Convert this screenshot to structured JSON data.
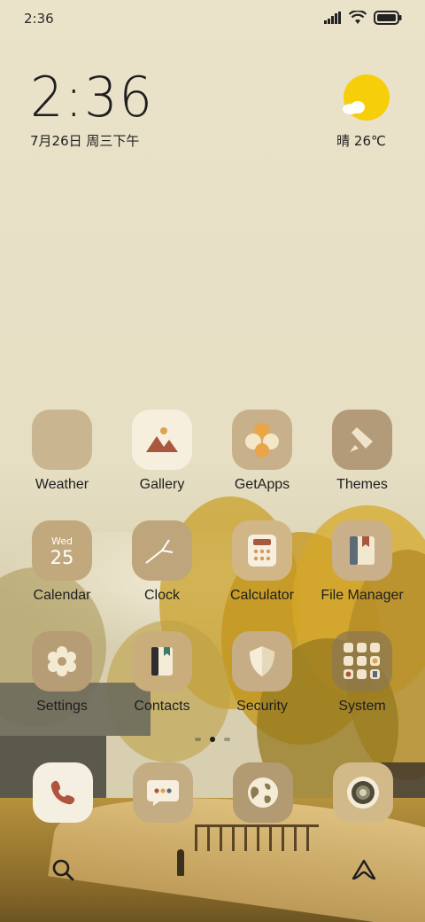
{
  "status_bar": {
    "time": "2:36"
  },
  "clock": {
    "time": "2:36",
    "date": "7月26日 周三下午"
  },
  "weather": {
    "text": "晴 26℃"
  },
  "apps": [
    {
      "label": "Weather",
      "icon": "weather-icon"
    },
    {
      "label": "Gallery",
      "icon": "gallery-icon"
    },
    {
      "label": "GetApps",
      "icon": "getapps-icon"
    },
    {
      "label": "Themes",
      "icon": "themes-icon"
    },
    {
      "label": "Calendar",
      "icon": "calendar-icon",
      "weekday": "Wed",
      "day": "25"
    },
    {
      "label": "Clock",
      "icon": "clock-icon"
    },
    {
      "label": "Calculator",
      "icon": "calculator-icon"
    },
    {
      "label": "File Manager",
      "icon": "file-manager-icon"
    },
    {
      "label": "Settings",
      "icon": "settings-icon"
    },
    {
      "label": "Contacts",
      "icon": "contacts-icon"
    },
    {
      "label": "Security",
      "icon": "security-icon"
    },
    {
      "label": "System",
      "icon": "folder-icon"
    }
  ],
  "dock": [
    {
      "icon": "phone-icon"
    },
    {
      "icon": "messages-icon"
    },
    {
      "icon": "browser-icon"
    },
    {
      "icon": "camera-icon"
    }
  ],
  "colors": {
    "icon_tan": "#c7b48f",
    "icon_cream": "#f3ecdc",
    "accent_brown": "#a8593d",
    "sun_yellow": "#f6cf0a"
  }
}
